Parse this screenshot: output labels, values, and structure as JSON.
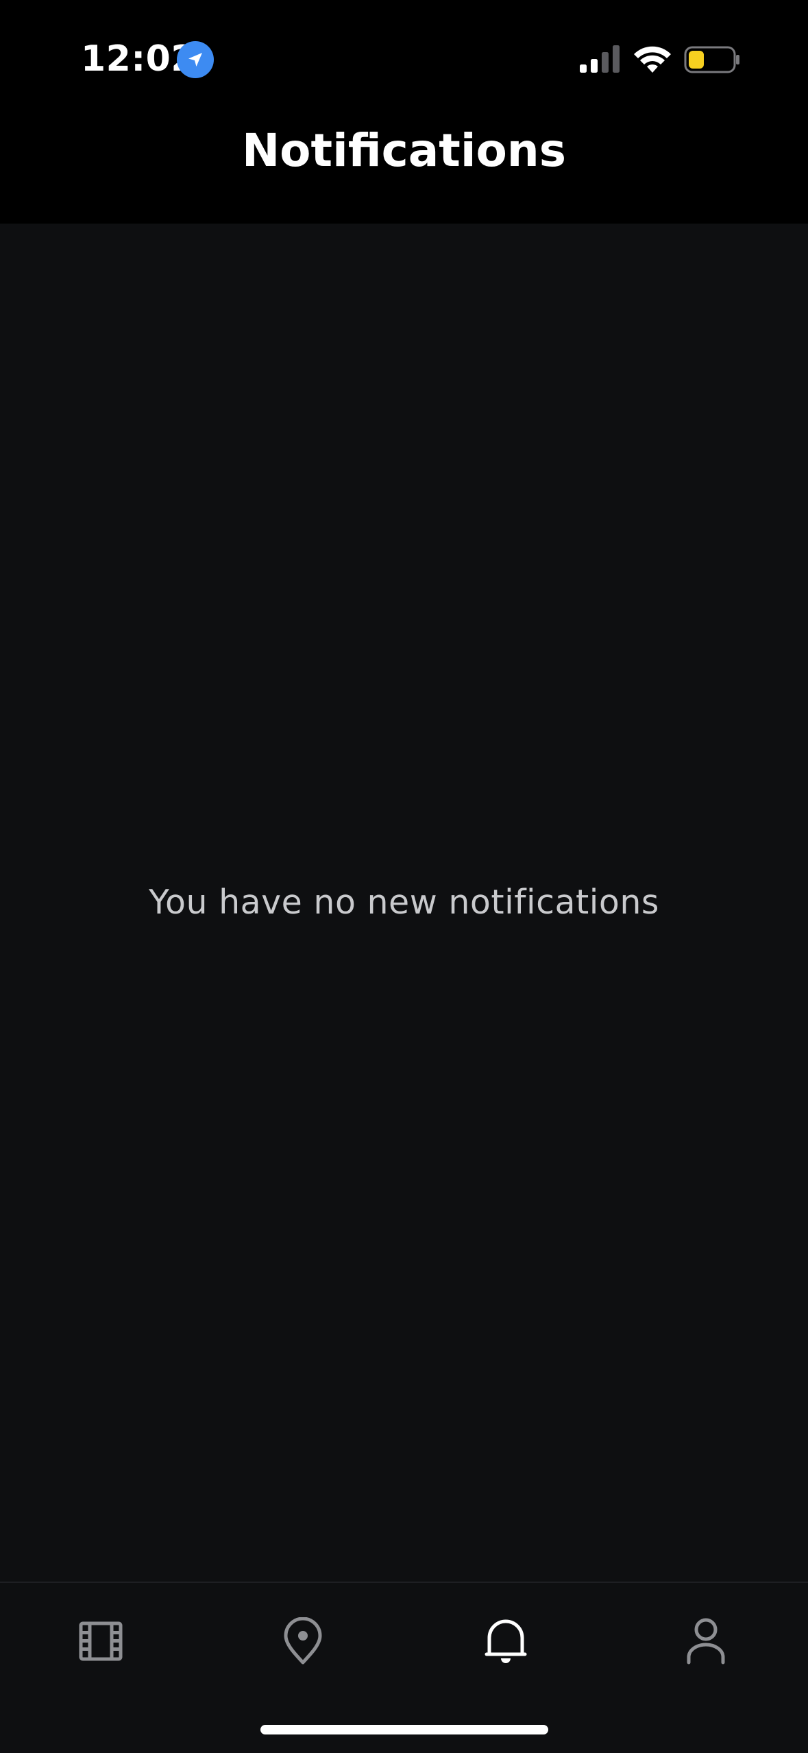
{
  "status_bar": {
    "time": "12:02",
    "location_icon": "location-arrow-icon",
    "signal_icon": "cellular-signal-icon",
    "wifi_icon": "wifi-icon",
    "battery_icon": "battery-icon",
    "battery_color": "#f7d020",
    "accent_color": "#3d8bf2"
  },
  "header": {
    "title": "Notifications"
  },
  "main": {
    "empty_message": "You have no new notifications"
  },
  "tab_bar": {
    "items": [
      {
        "icon": "film-icon",
        "active": false
      },
      {
        "icon": "map-pin-icon",
        "active": false
      },
      {
        "icon": "bell-icon",
        "active": true
      },
      {
        "icon": "user-icon",
        "active": false
      }
    ],
    "active_color": "#ffffff",
    "inactive_color": "#8e8f93"
  }
}
